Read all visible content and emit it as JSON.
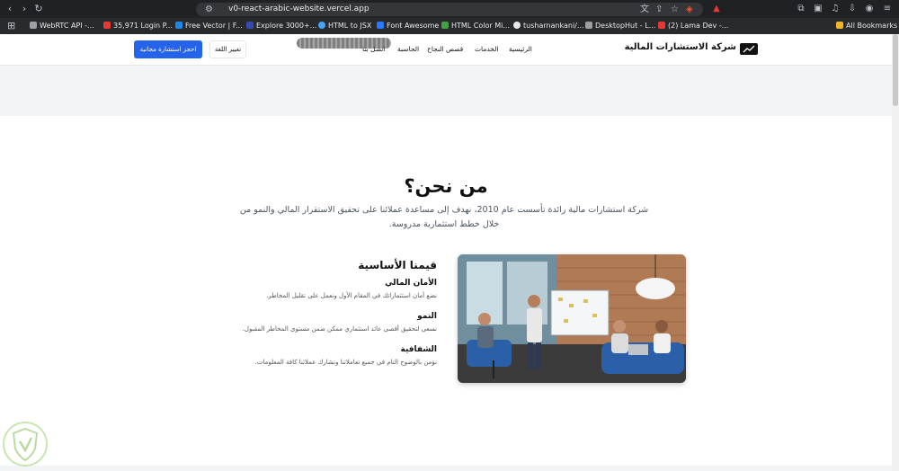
{
  "browser": {
    "url": "v0-react-arabic-website.vercel.app",
    "bookmarks": [
      {
        "label": "WebRTC API -...",
        "color": "#9aa0a6"
      },
      {
        "label": "35,971 Login P...",
        "color": "#e53935"
      },
      {
        "label": "Free Vector | F...",
        "color": "#1e88e5"
      },
      {
        "label": "Explore 3000+...",
        "color": "#3949ab"
      },
      {
        "label": "HTML to JSX",
        "color": "#42a5f5"
      },
      {
        "label": "Font Awesome",
        "color": "#2979ff"
      },
      {
        "label": "HTML Color Mi...",
        "color": "#43a047"
      },
      {
        "label": "tusharnankani/...",
        "color": "#e8eaed"
      },
      {
        "label": "DesktopHut - L...",
        "color": "#9e9e9e"
      },
      {
        "label": "(2) Lama Dev -...",
        "color": "#e53935"
      }
    ],
    "all_bookmarks": "All Bookmarks"
  },
  "header": {
    "brand": "شركة الاستشارات المالية",
    "nav": [
      "الرئيسية",
      "الخدمات",
      "قصص النجاح",
      "الحاسبة",
      "اتصل بنا"
    ],
    "lang_button": "تغيير اللغة",
    "cta_button": "احجز استشارة مجانية"
  },
  "about": {
    "title": "من نحن؟",
    "text": "شركة استشارات مالية رائدة تأسست عام 2010، نهدف إلى مساعدة عملائنا على تحقيق الاستقرار المالي والنمو من خلال خطط استثمارية مدروسة."
  },
  "values": {
    "heading": "قيمنا الأساسية",
    "items": [
      {
        "title": "الأمان المالي",
        "desc": "نضع أمان استثماراتك في المقام الأول ونعمل على تقليل المخاطر."
      },
      {
        "title": "النمو",
        "desc": "نسعى لتحقيق أقصى عائد استثماري ممكن ضمن مستوى المخاطر المقبول."
      },
      {
        "title": "الشفافية",
        "desc": "نؤمن بالوضوح التام في جميع تعاملاتنا ونشارك عملائنا كافة المعلومات."
      }
    ]
  },
  "colors": {
    "primary": "#2563eb",
    "chrome": "#202124",
    "band": "#f3f4f6"
  }
}
